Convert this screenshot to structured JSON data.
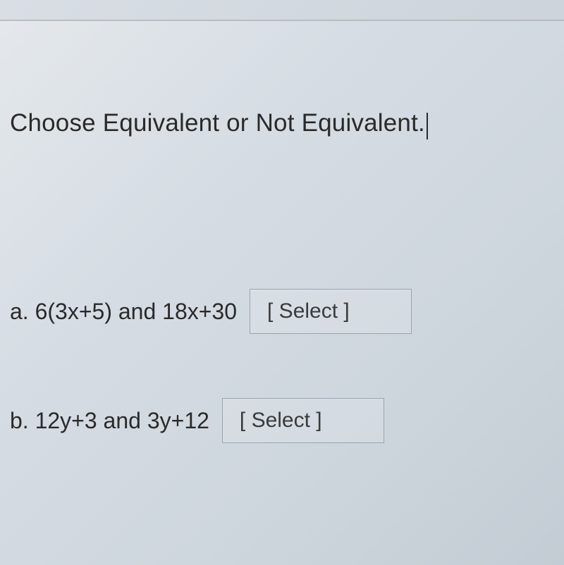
{
  "heading": "Choose Equivalent or Not Equivalent.",
  "questions": {
    "a": {
      "label": "a.",
      "expression": "6(3x+5) and 18x+30",
      "select_placeholder": "[ Select ]"
    },
    "b": {
      "label": "b.",
      "expression": "12y+3 and 3y+12",
      "select_placeholder": "[ Select ]"
    }
  }
}
